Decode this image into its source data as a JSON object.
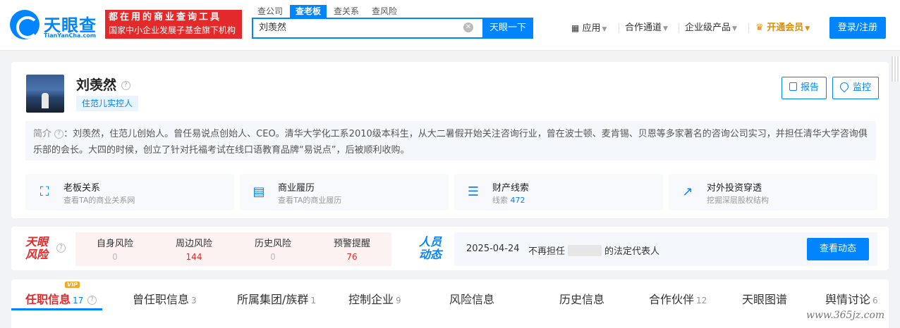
{
  "header": {
    "logo_text": "天眼查",
    "logo_sub": "TianYanCha.com",
    "ad_line1": "都在用的商业查询工具",
    "ad_line2": "国家中小企业发展子基金旗下机构",
    "search_tabs": [
      "查公司",
      "查老板",
      "查关系",
      "查风险"
    ],
    "search_value": "刘羡然",
    "search_button": "天眼一下",
    "nav": {
      "apps": "应用",
      "partner": "合作通道",
      "enterprise": "企业级产品",
      "vip": "开通会员",
      "login": "登录/注册"
    }
  },
  "profile": {
    "name": "刘羡然",
    "tag": "住范儿实控人",
    "report_button": "报告",
    "monitor_button": "监控",
    "intro_label": "简介",
    "intro_text": "：刘羡然，住范儿创始人。曾任易说点创始人、CEO。清华大学化工系2010级本科生，从大二暑假开始关注咨询行业，曾在波士顿、麦肯锡、贝恩等多家著名的咨询公司实习，并担任清华大学咨询俱乐部的会长。大四的时候，创立了针对托福考试在线口语教育品牌“易说点”，后被顺利收购。",
    "features": [
      {
        "title": "老板关系",
        "sub": "查看TA的商业关系网"
      },
      {
        "title": "商业履历",
        "sub": "查看TA的商业履历"
      },
      {
        "title": "财产线索",
        "sub_prefix": "线索",
        "sub_value": "472"
      },
      {
        "title": "对外投资穿透",
        "sub": "挖掘深层股权结构"
      }
    ]
  },
  "risk": {
    "logo_line1": "天眼",
    "logo_line2": "风险",
    "items": [
      {
        "label": "自身风险",
        "value": "0"
      },
      {
        "label": "周边风险",
        "value": "144"
      },
      {
        "label": "历史风险",
        "value": "0"
      },
      {
        "label": "预警提醒",
        "value": "76"
      }
    ],
    "colors": {
      "risk_red": "#e3292a",
      "muted": "#bbbbbb"
    }
  },
  "dynamics": {
    "logo_line1": "人员",
    "logo_line2": "动态",
    "date": "2025-04-24",
    "text_before": "不再担任",
    "text_after": "的法定代表人",
    "button": "查看动态"
  },
  "tabs": [
    {
      "label": "任职信息",
      "count": "17",
      "badge": "VIP"
    },
    {
      "label": "曾任职信息",
      "count": "3"
    },
    {
      "label": "所属集团/族群",
      "count": "1"
    },
    {
      "label": "控制企业",
      "count": "9"
    },
    {
      "label": "风险信息",
      "count": ""
    },
    {
      "label": "历史信息",
      "count": ""
    },
    {
      "label": "合作伙伴",
      "count": "12"
    },
    {
      "label": "天眼图谱",
      "count": ""
    },
    {
      "label": "舆情讨论",
      "count": "6"
    }
  ],
  "watermark": "www.365jz.com",
  "colors": {
    "brand_blue": "#0084ff",
    "ad_red": "#e3292a",
    "vip_gold": "#e28e00"
  }
}
